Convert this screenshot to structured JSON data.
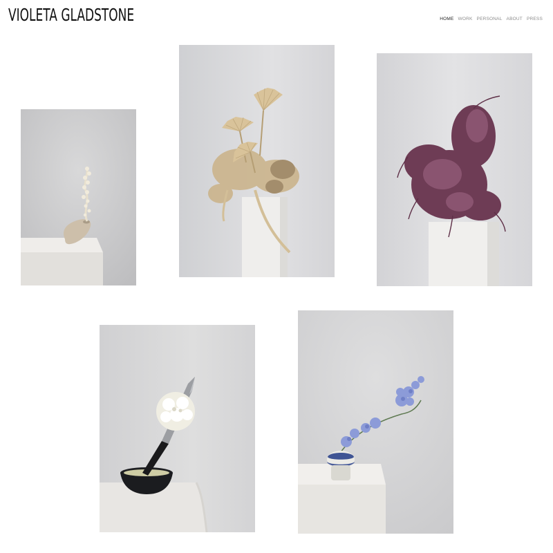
{
  "site": {
    "title": "VIOLETA GLADSTONE"
  },
  "nav": {
    "items": [
      {
        "label": "HOME",
        "active": true
      },
      {
        "label": "WORK",
        "active": false
      },
      {
        "label": "PERSONAL",
        "active": false
      },
      {
        "label": "ABOUT",
        "active": false
      },
      {
        "label": "PRESS",
        "active": false
      }
    ]
  },
  "gallery": {
    "images": [
      {
        "subject": "dried white stem in ceramic vase on plinth",
        "colors": {
          "wall": "#cfcfd0",
          "plinth": "#e6e4e1",
          "flower": "#eee7d8",
          "vase": "#cfc3b1"
        }
      },
      {
        "subject": "dried palm leaves and golden foliage on tall plinth",
        "colors": {
          "wall": "#d9d9dc",
          "plinth": "#ecebe9",
          "flower": "#d8c29a"
        }
      },
      {
        "subject": "purple heather arrangement on plinth",
        "colors": {
          "wall": "#dcdcdf",
          "plinth": "#eeedeb",
          "flower": "#6f3f55"
        }
      },
      {
        "subject": "white dahlia with knife in black bowl",
        "colors": {
          "wall": "#d4d4d6",
          "cloth": "#e9e8e6",
          "flower": "#f1efe6",
          "bowl": "#1e1f22"
        }
      },
      {
        "subject": "blue delphinium in striped vase on plinth",
        "colors": {
          "wall": "#d6d6d8",
          "plinth": "#eceae8",
          "flower": "#8c9bd8",
          "vase": "#4a5d9a"
        }
      }
    ]
  }
}
